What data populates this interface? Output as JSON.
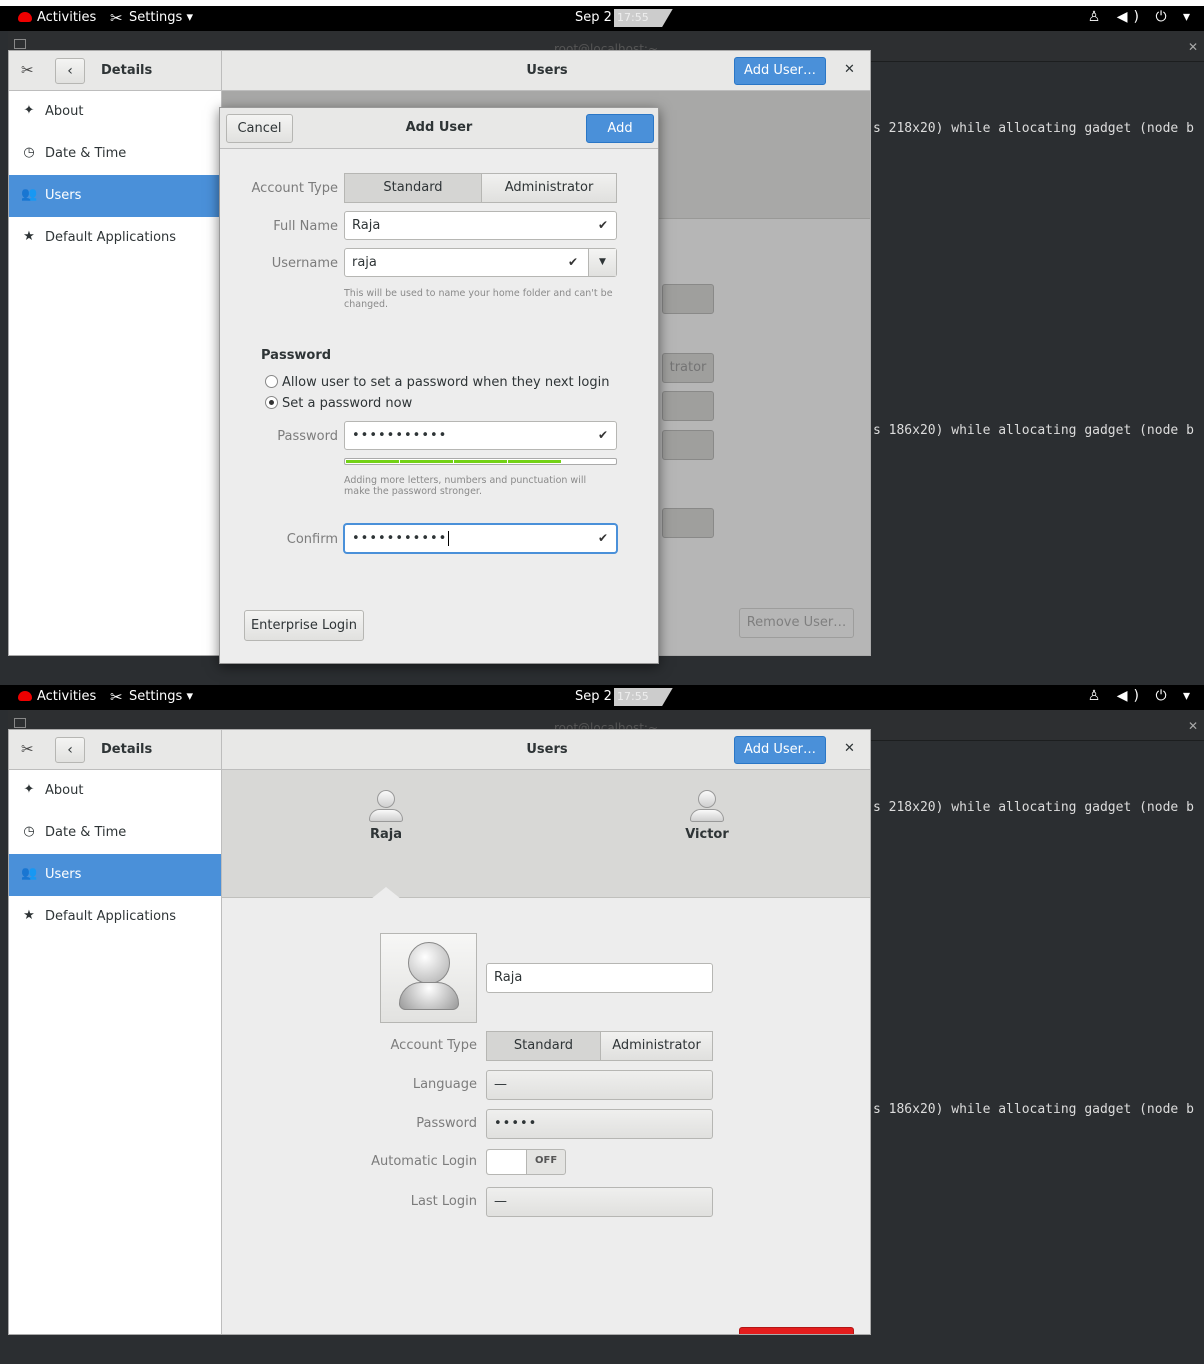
{
  "topbar": {
    "activities": "Activities",
    "app_menu": "Settings ▾",
    "date": "Sep 2",
    "time": "17:55",
    "system_icons": "♙ ◀) ⏻ ▾"
  },
  "terminal": {
    "title": "root@localhost:~",
    "line1": "s 218x20) while allocating gadget (node b",
    "line2": "s 186x20) while allocating gadget (node b"
  },
  "settings": {
    "panel_title": "Details",
    "page_title": "Users",
    "add_user": "Add User…",
    "sidebar": [
      {
        "label": "About",
        "icon": "plus-star-icon"
      },
      {
        "label": "Date & Time",
        "icon": "clock-icon"
      },
      {
        "label": "Users",
        "icon": "users-icon"
      },
      {
        "label": "Default Applications",
        "icon": "star-icon"
      }
    ],
    "remove_user": "Remove User…"
  },
  "dialog": {
    "cancel": "Cancel",
    "title": "Add User",
    "add": "Add",
    "account_type_label": "Account Type",
    "standard": "Standard",
    "administrator": "Administrator",
    "full_name_label": "Full Name",
    "full_name": "Raja",
    "username_label": "Username",
    "username": "raja",
    "username_hint": "This will be used to name your home folder and can't be changed.",
    "password_section": "Password",
    "radio_allow": "Allow user to set a password when they next login",
    "radio_set": "Set a password now",
    "password_label": "Password",
    "password_value": "•••••••••••",
    "password_strength": 0.8,
    "password_hint": "Adding more letters, numbers and punctuation will make the password stronger.",
    "confirm_label": "Confirm",
    "confirm_value": "•••••••••••",
    "enterprise_login": "Enterprise Login",
    "background_admin": "trator"
  },
  "user_page": {
    "users": [
      {
        "name": "Raja"
      },
      {
        "name": "Victor"
      }
    ],
    "name_value": "Raja",
    "account_type_label": "Account Type",
    "standard": "Standard",
    "administrator": "Administrator",
    "language_label": "Language",
    "language_value": "—",
    "password_label": "Password",
    "password_value": "•••••",
    "auto_login_label": "Automatic Login",
    "auto_login_value": "OFF",
    "last_login_label": "Last Login",
    "last_login_value": "—"
  },
  "colors": {
    "accent": "#4a90d9",
    "destructive": "#e41d1d",
    "strength": "#73d216"
  }
}
